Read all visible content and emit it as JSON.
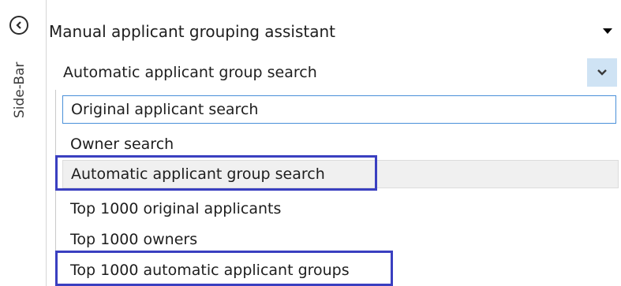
{
  "sidebar": {
    "label": "Side-Bar",
    "collapse_icon": "chevron-left-icon"
  },
  "assistant": {
    "title": "Manual applicant grouping assistant",
    "dropdown_icon": "caret-down-icon"
  },
  "search_mode": {
    "selected_value": "Automatic applicant group search",
    "button_icon": "chevron-down-icon",
    "options": [
      {
        "label": "Original applicant search"
      },
      {
        "label": "Owner search"
      },
      {
        "label": "Automatic applicant group search"
      },
      {
        "label": "Top 1000 original applicants"
      },
      {
        "label": "Top 1000 owners"
      },
      {
        "label": "Top 1000 automatic applicant groups"
      }
    ]
  },
  "colors": {
    "highlight_border": "#3a3fc0",
    "combo_button_bg": "#cfe3f4",
    "focus_border": "#4a90d9"
  }
}
